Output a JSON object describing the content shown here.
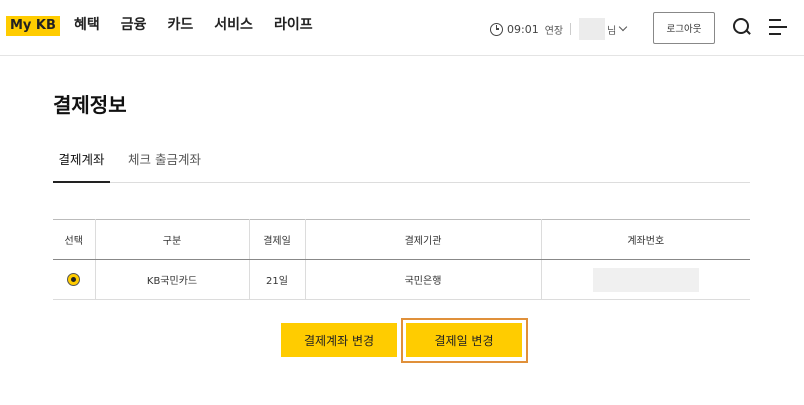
{
  "header": {
    "logo": "My KB",
    "nav": [
      "혜택",
      "금융",
      "카드",
      "서비스",
      "라이프"
    ],
    "session_time": "09:01",
    "extend_label": "연장",
    "user_suffix": "님",
    "logout_label": "로그아웃"
  },
  "page": {
    "title": "결제정보",
    "tabs": [
      {
        "label": "결제계좌",
        "active": true
      },
      {
        "label": "체크 출금계좌",
        "active": false
      }
    ]
  },
  "table": {
    "headers": [
      "선택",
      "구분",
      "결제일",
      "결제기관",
      "계좌번호"
    ],
    "rows": [
      {
        "selected": true,
        "type": "KB국민카드",
        "pay_day": "21일",
        "institution": "국민은행",
        "account": ""
      }
    ]
  },
  "actions": {
    "change_account": "결제계좌 변경",
    "change_date": "결제일 변경"
  },
  "colors": {
    "accent": "#ffcc00",
    "highlight_outline": "#e0903a"
  }
}
